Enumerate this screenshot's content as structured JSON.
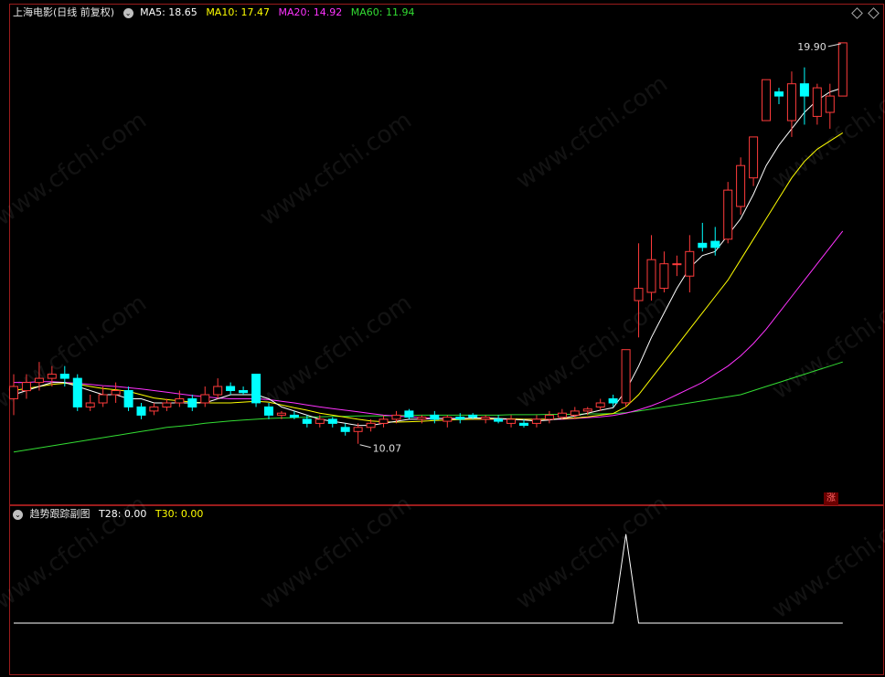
{
  "header": {
    "title": "上海电影(日线 前复权)",
    "ma5_label": "MA5: 18.65",
    "ma10_label": "MA10: 17.47",
    "ma20_label": "MA20: 14.92",
    "ma60_label": "MA60: 11.94"
  },
  "sub_header": {
    "title": "趋势跟踪副图",
    "t28_label": "T28: 0.00",
    "t30_label": "T30: 0.00"
  },
  "badge": "涨",
  "watermark": "www.cfchi.com",
  "colors": {
    "up": "#ff3b3b",
    "down": "#00ffff",
    "ma5": "#ffffff",
    "ma10": "#ffff00",
    "ma20": "#ff33ff",
    "ma60": "#33dd33",
    "border": "#9b1c1c"
  },
  "chart_data": [
    {
      "type": "candlestick",
      "title": "上海电影(日线 前复权)",
      "high_label": "19.90",
      "low_label": "10.07",
      "ylim": [
        9.0,
        20.5
      ],
      "candles": [
        {
          "o": 11.2,
          "c": 11.5,
          "h": 11.8,
          "l": 10.8
        },
        {
          "o": 11.4,
          "c": 11.6,
          "h": 11.8,
          "l": 11.2
        },
        {
          "o": 11.6,
          "c": 11.7,
          "h": 12.1,
          "l": 11.4
        },
        {
          "o": 11.7,
          "c": 11.8,
          "h": 12.0,
          "l": 11.5
        },
        {
          "o": 11.8,
          "c": 11.7,
          "h": 12.0,
          "l": 11.5
        },
        {
          "o": 11.7,
          "c": 11.0,
          "h": 11.8,
          "l": 10.9
        },
        {
          "o": 11.0,
          "c": 11.1,
          "h": 11.3,
          "l": 10.9
        },
        {
          "o": 11.1,
          "c": 11.3,
          "h": 11.5,
          "l": 11.0
        },
        {
          "o": 11.3,
          "c": 11.4,
          "h": 11.6,
          "l": 11.1
        },
        {
          "o": 11.4,
          "c": 11.0,
          "h": 11.5,
          "l": 10.9
        },
        {
          "o": 11.0,
          "c": 10.8,
          "h": 11.1,
          "l": 10.7
        },
        {
          "o": 10.9,
          "c": 11.0,
          "h": 11.1,
          "l": 10.8
        },
        {
          "o": 11.0,
          "c": 11.1,
          "h": 11.2,
          "l": 10.9
        },
        {
          "o": 11.1,
          "c": 11.2,
          "h": 11.4,
          "l": 11.0
        },
        {
          "o": 11.2,
          "c": 11.0,
          "h": 11.3,
          "l": 10.9
        },
        {
          "o": 11.1,
          "c": 11.3,
          "h": 11.5,
          "l": 11.0
        },
        {
          "o": 11.3,
          "c": 11.5,
          "h": 11.7,
          "l": 11.2
        },
        {
          "o": 11.5,
          "c": 11.4,
          "h": 11.6,
          "l": 11.3
        },
        {
          "o": 11.4,
          "c": 11.35,
          "h": 11.5,
          "l": 11.3
        },
        {
          "o": 11.8,
          "c": 11.1,
          "h": 11.8,
          "l": 11.0
        },
        {
          "o": 11.0,
          "c": 10.8,
          "h": 11.1,
          "l": 10.7
        },
        {
          "o": 10.8,
          "c": 10.85,
          "h": 10.9,
          "l": 10.7
        },
        {
          "o": 10.8,
          "c": 10.75,
          "h": 10.9,
          "l": 10.7
        },
        {
          "o": 10.7,
          "c": 10.6,
          "h": 10.8,
          "l": 10.5
        },
        {
          "o": 10.6,
          "c": 10.7,
          "h": 10.8,
          "l": 10.5
        },
        {
          "o": 10.7,
          "c": 10.6,
          "h": 10.75,
          "l": 10.5
        },
        {
          "o": 10.5,
          "c": 10.4,
          "h": 10.6,
          "l": 10.3
        },
        {
          "o": 10.4,
          "c": 10.5,
          "h": 10.6,
          "l": 10.1
        },
        {
          "o": 10.5,
          "c": 10.6,
          "h": 10.7,
          "l": 10.4
        },
        {
          "o": 10.6,
          "c": 10.7,
          "h": 10.8,
          "l": 10.5
        },
        {
          "o": 10.7,
          "c": 10.8,
          "h": 10.9,
          "l": 10.6
        },
        {
          "o": 10.9,
          "c": 10.75,
          "h": 10.95,
          "l": 10.7
        },
        {
          "o": 10.7,
          "c": 10.75,
          "h": 10.8,
          "l": 10.6
        },
        {
          "o": 10.8,
          "c": 10.7,
          "h": 10.9,
          "l": 10.6
        },
        {
          "o": 10.65,
          "c": 10.75,
          "h": 10.8,
          "l": 10.5
        },
        {
          "o": 10.75,
          "c": 10.7,
          "h": 10.85,
          "l": 10.6
        },
        {
          "o": 10.8,
          "c": 10.75,
          "h": 10.85,
          "l": 10.7
        },
        {
          "o": 10.7,
          "c": 10.75,
          "h": 10.8,
          "l": 10.6
        },
        {
          "o": 10.7,
          "c": 10.65,
          "h": 10.8,
          "l": 10.6
        },
        {
          "o": 10.6,
          "c": 10.7,
          "h": 10.8,
          "l": 10.5
        },
        {
          "o": 10.6,
          "c": 10.55,
          "h": 10.7,
          "l": 10.5
        },
        {
          "o": 10.6,
          "c": 10.7,
          "h": 10.8,
          "l": 10.5
        },
        {
          "o": 10.7,
          "c": 10.8,
          "h": 10.9,
          "l": 10.6
        },
        {
          "o": 10.75,
          "c": 10.85,
          "h": 10.95,
          "l": 10.7
        },
        {
          "o": 10.8,
          "c": 10.9,
          "h": 11.0,
          "l": 10.7
        },
        {
          "o": 10.9,
          "c": 10.95,
          "h": 11.0,
          "l": 10.8
        },
        {
          "o": 11.0,
          "c": 11.1,
          "h": 11.2,
          "l": 10.9
        },
        {
          "o": 11.2,
          "c": 11.1,
          "h": 11.3,
          "l": 11.0
        },
        {
          "o": 11.1,
          "c": 12.4,
          "h": 12.4,
          "l": 11.0
        },
        {
          "o": 13.6,
          "c": 13.9,
          "h": 15.0,
          "l": 12.7
        },
        {
          "o": 13.8,
          "c": 14.6,
          "h": 15.2,
          "l": 13.6
        },
        {
          "o": 13.9,
          "c": 14.5,
          "h": 14.8,
          "l": 13.8
        },
        {
          "o": 14.5,
          "c": 14.5,
          "h": 14.7,
          "l": 14.2
        },
        {
          "o": 14.2,
          "c": 14.8,
          "h": 15.2,
          "l": 13.8
        },
        {
          "o": 15.0,
          "c": 14.9,
          "h": 15.5,
          "l": 14.8
        },
        {
          "o": 15.05,
          "c": 14.9,
          "h": 15.4,
          "l": 14.7
        },
        {
          "o": 15.1,
          "c": 16.3,
          "h": 16.5,
          "l": 15.0
        },
        {
          "o": 15.9,
          "c": 16.9,
          "h": 17.1,
          "l": 15.7
        },
        {
          "o": 16.6,
          "c": 17.6,
          "h": 17.6,
          "l": 16.4
        },
        {
          "o": 18.0,
          "c": 19.0,
          "h": 19.0,
          "l": 18.6
        },
        {
          "o": 18.7,
          "c": 18.6,
          "h": 18.8,
          "l": 18.4
        },
        {
          "o": 18.0,
          "c": 18.9,
          "h": 19.2,
          "l": 17.6
        },
        {
          "o": 18.9,
          "c": 18.6,
          "h": 19.3,
          "l": 17.9
        },
        {
          "o": 18.1,
          "c": 18.8,
          "h": 18.9,
          "l": 17.9
        },
        {
          "o": 18.2,
          "c": 18.6,
          "h": 18.9,
          "l": 17.8
        },
        {
          "o": 18.6,
          "c": 19.9,
          "h": 19.9,
          "l": 18.6
        }
      ],
      "ma5": [
        11.3,
        11.4,
        11.5,
        11.6,
        11.6,
        11.5,
        11.4,
        11.3,
        11.3,
        11.2,
        11.2,
        11.1,
        11.1,
        11.1,
        11.1,
        11.1,
        11.2,
        11.3,
        11.3,
        11.3,
        11.2,
        11.0,
        10.9,
        10.8,
        10.7,
        10.65,
        10.6,
        10.55,
        10.55,
        10.6,
        10.65,
        10.7,
        10.7,
        10.72,
        10.72,
        10.72,
        10.73,
        10.73,
        10.72,
        10.7,
        10.68,
        10.66,
        10.68,
        10.72,
        10.78,
        10.85,
        10.92,
        10.98,
        11.4,
        12.0,
        12.7,
        13.3,
        13.9,
        14.4,
        14.7,
        14.8,
        15.2,
        15.6,
        16.2,
        16.9,
        17.4,
        17.8,
        18.2,
        18.5,
        18.7,
        18.8
      ],
      "ma10": [
        11.4,
        11.45,
        11.5,
        11.55,
        11.58,
        11.56,
        11.5,
        11.45,
        11.42,
        11.38,
        11.3,
        11.22,
        11.18,
        11.15,
        11.12,
        11.1,
        11.1,
        11.1,
        11.12,
        11.14,
        11.12,
        11.05,
        10.98,
        10.92,
        10.85,
        10.8,
        10.75,
        10.7,
        10.66,
        10.64,
        10.63,
        10.64,
        10.65,
        10.67,
        10.68,
        10.69,
        10.7,
        10.7,
        10.71,
        10.71,
        10.7,
        10.7,
        10.7,
        10.71,
        10.73,
        10.76,
        10.8,
        10.84,
        11.0,
        11.3,
        11.7,
        12.1,
        12.5,
        12.9,
        13.3,
        13.7,
        14.1,
        14.6,
        15.1,
        15.6,
        16.1,
        16.6,
        17.0,
        17.3,
        17.5,
        17.7
      ],
      "ma20": [
        11.6,
        11.6,
        11.62,
        11.62,
        11.6,
        11.58,
        11.55,
        11.52,
        11.5,
        11.47,
        11.44,
        11.4,
        11.36,
        11.32,
        11.28,
        11.25,
        11.22,
        11.2,
        11.2,
        11.2,
        11.18,
        11.14,
        11.1,
        11.05,
        11.0,
        10.96,
        10.92,
        10.88,
        10.84,
        10.8,
        10.78,
        10.76,
        10.74,
        10.72,
        10.71,
        10.7,
        10.7,
        10.7,
        10.7,
        10.7,
        10.7,
        10.7,
        10.7,
        10.7,
        10.72,
        10.74,
        10.76,
        10.79,
        10.85,
        10.93,
        11.03,
        11.15,
        11.3,
        11.45,
        11.6,
        11.8,
        12.0,
        12.25,
        12.55,
        12.9,
        13.3,
        13.7,
        14.1,
        14.5,
        14.9,
        15.3
      ],
      "ma60": [
        9.9,
        9.95,
        10.0,
        10.05,
        10.1,
        10.15,
        10.2,
        10.25,
        10.3,
        10.35,
        10.4,
        10.45,
        10.5,
        10.53,
        10.56,
        10.6,
        10.63,
        10.66,
        10.68,
        10.7,
        10.72,
        10.73,
        10.74,
        10.75,
        10.76,
        10.77,
        10.77,
        10.78,
        10.78,
        10.78,
        10.79,
        10.79,
        10.8,
        10.8,
        10.8,
        10.8,
        10.8,
        10.8,
        10.8,
        10.81,
        10.81,
        10.81,
        10.82,
        10.82,
        10.82,
        10.83,
        10.83,
        10.84,
        10.86,
        10.9,
        10.95,
        11.0,
        11.05,
        11.1,
        11.15,
        11.2,
        11.25,
        11.3,
        11.4,
        11.5,
        11.6,
        11.7,
        11.8,
        11.9,
        12.0,
        12.1
      ]
    },
    {
      "type": "line",
      "title": "趋势跟踪副图",
      "series": [
        {
          "name": "T28",
          "values": [
            0,
            0,
            0,
            0,
            0,
            0,
            0,
            0,
            0,
            0,
            0,
            0,
            0,
            0,
            0,
            0,
            0,
            0,
            0,
            0,
            0,
            0,
            0,
            0,
            0,
            0,
            0,
            0,
            0,
            0,
            0,
            0,
            0,
            0,
            0,
            0,
            0,
            0,
            0,
            0,
            0,
            0,
            0,
            0,
            0,
            0,
            0,
            0,
            1,
            0,
            0,
            0,
            0,
            0,
            0,
            0,
            0,
            0,
            0,
            0,
            0,
            0,
            0,
            0,
            0,
            0
          ]
        }
      ],
      "ylim": [
        0,
        1.1
      ]
    }
  ]
}
